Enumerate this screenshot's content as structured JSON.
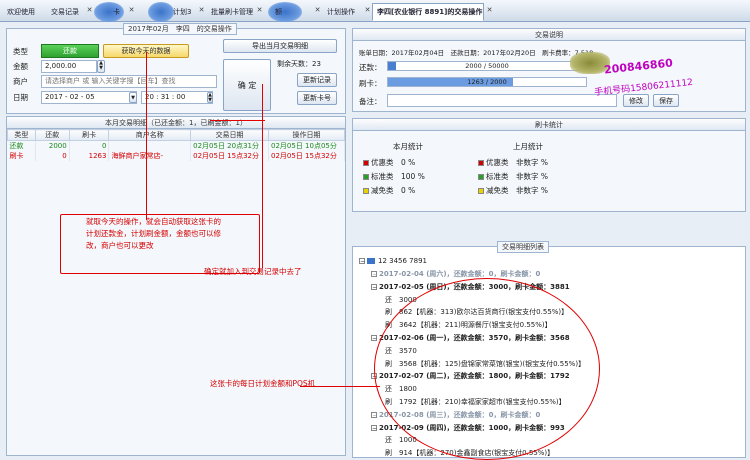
{
  "tabs": [
    {
      "label": "欢迎使用"
    },
    {
      "label": "交易记录"
    },
    {
      "label": "卡"
    },
    {
      "label": "计划3"
    },
    {
      "label": "批量刷卡管理"
    },
    {
      "label": "额"
    },
    {
      "label": "计划操作"
    },
    {
      "label": "李四[农业银行 8891]的交易操作"
    }
  ],
  "form": {
    "date_title": "2017年02月　李四　的交易操作",
    "type_label": "类型",
    "type_value": "还款",
    "fetch_today_button": "获取今天的数据",
    "amount_label": "金额",
    "amount_value": "2,000.00",
    "merchant_label": "商户",
    "merchant_placeholder": "请选择商户 或 输入关键字搜【回车】查找",
    "date_label": "日期",
    "date_value": "2017 - 02 - 05",
    "time_value": "20 : 31 : 00",
    "confirm_button": "确 定",
    "export_button": "导出当月交易明细",
    "unfinished_label": "剩余天数：23",
    "set_merchant_button": "更新记录",
    "set_card_button": "更新卡号"
  },
  "records": {
    "title": "本月交易明细（已还金额：1，已刷金额：1）",
    "columns": [
      "类型",
      "还款",
      "刷卡",
      "商户名称",
      "交易日期",
      "操作日期"
    ],
    "rows": [
      {
        "type": "还款",
        "repay": "2000",
        "swipe": "0",
        "merchant": "",
        "trade_date": "02月05日 20点31分",
        "op_date": "02月05日 10点05分"
      },
      {
        "type": "刷卡",
        "repay": "0",
        "swipe": "1263",
        "merchant": "海鲜商户家常店-",
        "trade_date": "02月05日 15点32分",
        "op_date": "02月05日 15点32分"
      }
    ]
  },
  "info": {
    "title": "交易说明",
    "line1": "账单日期：2017年02月04日　还款日期：2017年02月20日　刷卡费率：7.518",
    "repay_label": "还款：",
    "repay_progress": "2000 / 50000",
    "repay_ratio": 0.04,
    "swipe_label": "刷卡：",
    "swipe_progress": "1263 / 2000",
    "swipe_ratio": 0.63,
    "note_label": "备注：",
    "btn_a": "修改",
    "btn_b": "保存"
  },
  "stats": {
    "title": "刷卡统计",
    "this_month": "本月统计",
    "last_month": "上月统计",
    "left": [
      {
        "color": "#d40000",
        "text": "优惠类　0 %"
      },
      {
        "color": "#2aa02a",
        "text": "标准类　100 %"
      },
      {
        "color": "#e8d200",
        "text": "减免类　0 %"
      }
    ],
    "right": [
      {
        "color": "#d40000",
        "text": "优惠类　非数字 %"
      },
      {
        "color": "#2aa02a",
        "text": "标准类　非数字 %"
      },
      {
        "color": "#e8d200",
        "text": "减免类　非数字 %"
      }
    ]
  },
  "plan": {
    "title": "交易明细列表",
    "root": "12 3456 7891",
    "lines": [
      {
        "text": "2017-02-04 (周六)，还款金额：0，刷卡金额：0",
        "faded": true
      },
      {
        "text": "2017-02-05 (周日)，还款金额：3000，刷卡金额：3881",
        "faded": false
      },
      {
        "text": "还　3000",
        "faded": false
      },
      {
        "text": "刷　862【机器：313)欧尔达百货商行(银宝支付0.55%)】",
        "faded": false
      },
      {
        "text": "刷　3642【机器：211)明源餐厅(银宝支付0.55%)】",
        "faded": false
      },
      {
        "text": "2017-02-06 (周一)，还款金额：3570，刷卡金额：3568",
        "faded": false
      },
      {
        "text": "还　3570",
        "faded": false
      },
      {
        "text": "刷　3568【机器：125)盘锦家常菜馆(银宝)(银宝支付0.55%)】",
        "faded": false
      },
      {
        "text": "2017-02-07 (周二)，还款金额：1800，刷卡金额：1792",
        "faded": false
      },
      {
        "text": "还　1800",
        "faded": false
      },
      {
        "text": "刷　1792【机器：210)幸福家家超市(银宝支付0.55%)】",
        "faded": false
      },
      {
        "text": "2017-02-08 (周三)，还款金额：0，刷卡金额：0",
        "faded": true
      },
      {
        "text": "2017-02-09 (周四)，还款金额：1000，刷卡金额：993",
        "faded": false
      },
      {
        "text": "还　1000",
        "faded": false
      },
      {
        "text": "刷　914【机器：270)金鑫副食店(银宝支付0.55%)】",
        "faded": false
      }
    ]
  },
  "annotations": {
    "a1_line1": "就取今天的操作，就会自动获取这张卡的",
    "a1_line2": "计划还款金，计划刷金额，金额也可以修",
    "a1_line3": "改，商户也可以更改",
    "a2": "确定就加入到交易记录中去了",
    "a3": "这张卡的每日计划金额和POS机"
  },
  "watermark": {
    "qq": "200846860",
    "phone": "手机号码15806211112"
  }
}
